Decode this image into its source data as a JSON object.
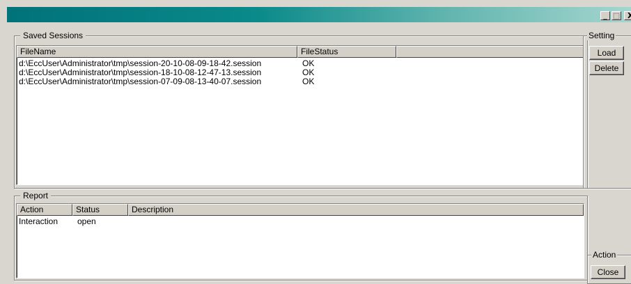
{
  "window": {
    "minimize_glyph": "_",
    "maximize_glyph": "□",
    "close_glyph": "X"
  },
  "sessions": {
    "title": "Saved Sessions",
    "columns": [
      "FileName",
      "FileStatus",
      ""
    ],
    "rows": [
      {
        "file": "d:\\EccUser\\Administrator\\tmp\\session-20-10-08-09-18-42.session",
        "status": "OK"
      },
      {
        "file": "d:\\EccUser\\Administrator\\tmp\\session-18-10-08-12-47-13.session",
        "status": "OK"
      },
      {
        "file": "d:\\EccUser\\Administrator\\tmp\\session-07-09-08-13-40-07.session",
        "status": "OK"
      }
    ]
  },
  "settings": {
    "title": "Setting",
    "load_label": "Load",
    "delete_label": "Delete"
  },
  "report": {
    "title": "Report",
    "columns": [
      "Action",
      "Status",
      "Description"
    ],
    "rows": [
      {
        "action": "Interaction",
        "status": "open",
        "description": ""
      }
    ]
  },
  "actions": {
    "title": "Action",
    "close_label": "Close"
  }
}
